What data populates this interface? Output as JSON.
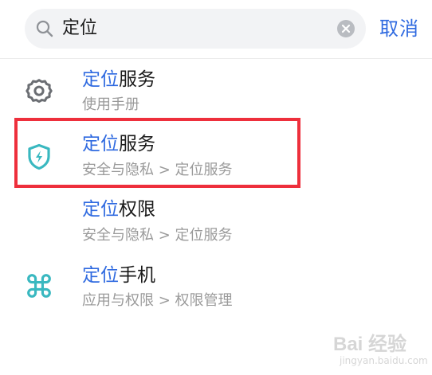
{
  "search": {
    "query": "定位",
    "cancel_label": "取消"
  },
  "results": [
    {
      "icon": "gear-icon",
      "title_highlight": "定位",
      "title_rest": "服务",
      "subtitle": "使用手册"
    },
    {
      "icon": "shield-lightning-icon",
      "title_highlight": "定位",
      "title_rest": "服务",
      "subtitle": "安全与隐私 > 定位服务"
    },
    {
      "icon": "",
      "title_highlight": "定位",
      "title_rest": "权限",
      "subtitle": "安全与隐私 > 定位服务"
    },
    {
      "icon": "command-icon",
      "title_highlight": "定位",
      "title_rest": "手机",
      "subtitle": "应用与权限 > 权限管理"
    }
  ],
  "watermark": {
    "main": "Bai 经验",
    "sub": "jingyan.baidu.com"
  },
  "colors": {
    "accent": "#2f6ae0",
    "icon_teal": "#39b8c0",
    "highlight_box": "#ee2f3c"
  }
}
